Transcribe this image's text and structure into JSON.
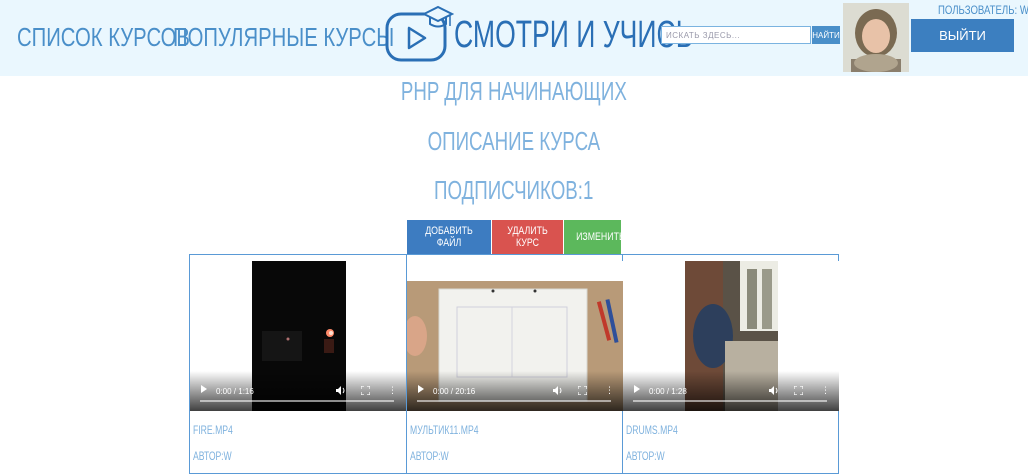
{
  "header": {
    "nav": [
      "СПИСОК КУРСОВ",
      "ПОПУЛЯРНЫЕ КУРСЫ"
    ],
    "brand": "СМОТРИ И УЧИСЬ",
    "search_placeholder": "ИСКАТЬ ЗДЕСЬ...",
    "search_button": "НАЙТИ",
    "user_label": "ПОЛЬЗОВАТЕЛЬ: W",
    "logout": "ВЫЙТИ"
  },
  "course": {
    "title": "PHP ДЛЯ НАЧИНАЮЩИХ",
    "description": "ОПИСАНИЕ КУРСА",
    "subscribers": "ПОДПИСЧИКОВ:1"
  },
  "actions": {
    "add_file": "ДОБАВИТЬ ФАЙЛ",
    "delete_course": "УДАЛИТЬ КУРС",
    "edit": "ИЗМЕНИТЬ"
  },
  "files": [
    {
      "name": "FIRE.MP4",
      "author": "АВТОР:W",
      "time": "0:00 / 1:16"
    },
    {
      "name": "МУЛЬТИК11.MP4",
      "author": "АВТОР:W",
      "time": "0:00 / 20:16"
    },
    {
      "name": "DRUMS.MP4",
      "author": "АВТОР:W",
      "time": "0:00 / 1:28"
    }
  ],
  "icons": {
    "logo": "play-screen-graduation-cap-icon",
    "play": "play-icon",
    "volume": "volume-icon",
    "fullscreen": "fullscreen-icon",
    "more": "more-vertical-icon"
  },
  "colors": {
    "header_bg": "#eaf7fe",
    "accent": "#3c7fc0",
    "delete": "#d9534f",
    "edit": "#5cb85c",
    "text_light": "#7fb2de"
  }
}
